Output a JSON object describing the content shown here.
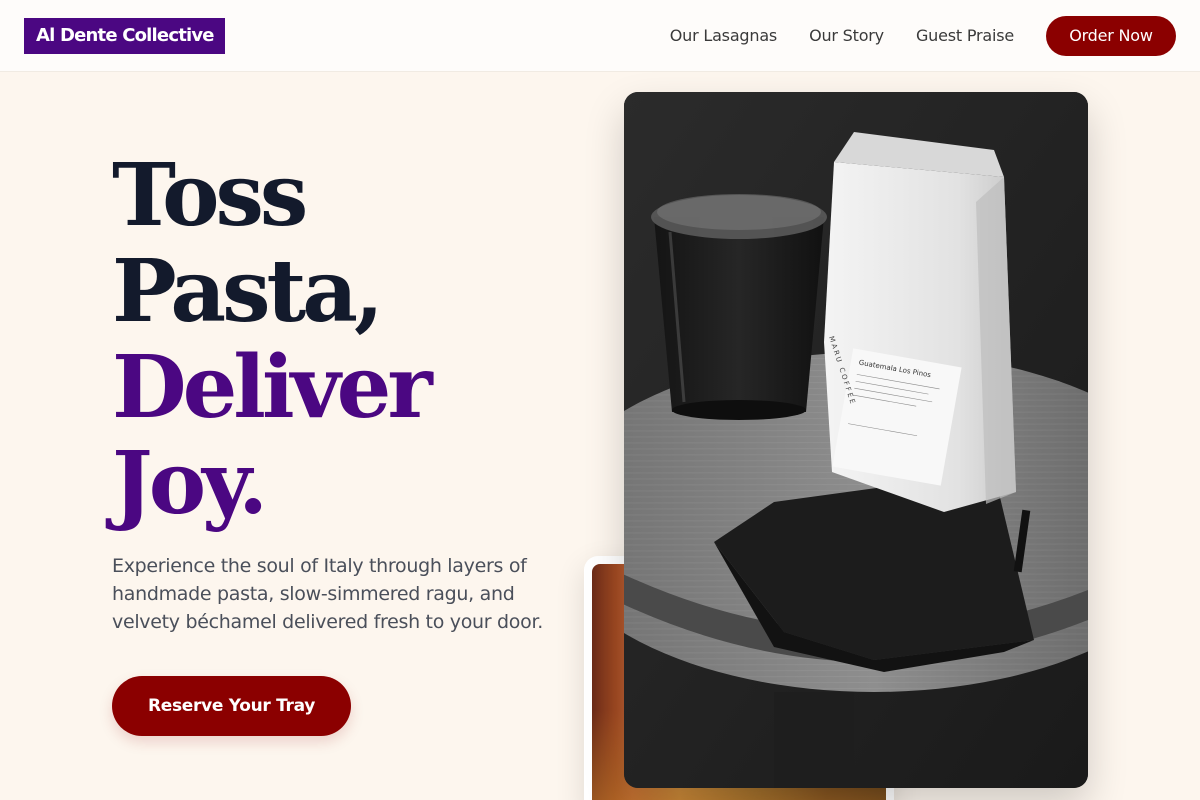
{
  "brand": {
    "logo_text": "Al Dente Collective"
  },
  "nav": {
    "links": [
      "Our Lasagnas",
      "Our Story",
      "Guest Praise"
    ],
    "cta_label": "Order Now"
  },
  "hero": {
    "headline_line1": "Toss",
    "headline_line2": "Pasta,",
    "headline_line3": "Deliver",
    "headline_line4": "Joy.",
    "lead": "Experience the soul of Italy through layers of handmade pasta, slow-simmered ragu, and velvety béchamel delivered fresh to your door.",
    "cta_label": "Reserve Your Tray"
  },
  "photo": {
    "bag_brand": "MARU COFFEE",
    "bag_label_title": "Guatemala Los Pinos"
  },
  "colors": {
    "background": "#fdf6ee",
    "brand_purple": "#4b0782",
    "brand_red": "#8b0000",
    "headline_dark": "#131a2c"
  }
}
